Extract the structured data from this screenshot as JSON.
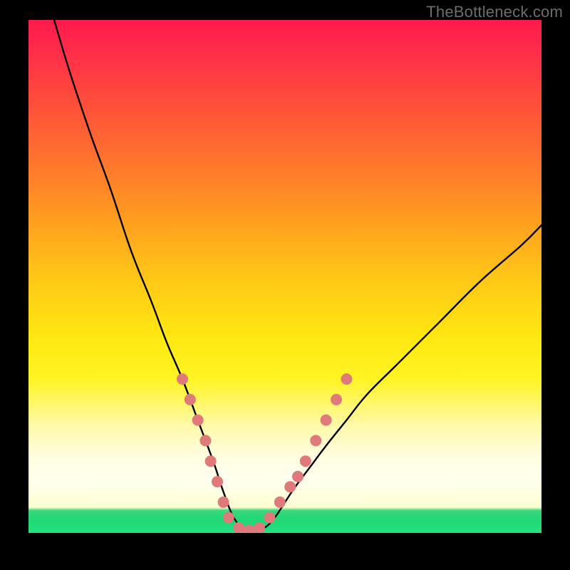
{
  "watermark": "TheBottleneck.com",
  "chart_data": {
    "type": "line",
    "title": "",
    "xlabel": "",
    "ylabel": "",
    "xlim": [
      0,
      100
    ],
    "ylim": [
      0,
      100
    ],
    "grid": false,
    "legend": false,
    "colors": {
      "curve": "#000000",
      "markers": "#e07a7a",
      "gradient_top": "#ff1a4d",
      "gradient_bottom": "#26e381"
    },
    "series": [
      {
        "name": "bottleneck-curve",
        "description": "V-shaped bottleneck-percentage curve; minimum (~0%) around x≈39..46, rising toward both ends. Left branch reaches 100% near x≈5; right branch reaches ~60% at x≈100.",
        "x": [
          5,
          8,
          12,
          16,
          20,
          24,
          27,
          30,
          33,
          36,
          38,
          40,
          42,
          44,
          46,
          48,
          50,
          52,
          55,
          58,
          62,
          66,
          72,
          80,
          88,
          96,
          100
        ],
        "values": [
          100,
          90,
          78,
          67,
          55,
          45,
          37,
          30,
          22,
          14,
          8,
          3,
          1,
          0.5,
          1,
          3,
          6,
          9,
          13,
          17,
          22,
          27,
          33,
          41,
          49,
          56,
          60
        ]
      }
    ],
    "markers": {
      "name": "highlight-dots",
      "description": "Salmon dots clustered on the lower portion of both branches and along the trough.",
      "points": [
        {
          "x": 30,
          "y": 30
        },
        {
          "x": 31.5,
          "y": 26
        },
        {
          "x": 33,
          "y": 22
        },
        {
          "x": 34.5,
          "y": 18
        },
        {
          "x": 35.5,
          "y": 14
        },
        {
          "x": 36.8,
          "y": 10
        },
        {
          "x": 38,
          "y": 6
        },
        {
          "x": 39,
          "y": 3
        },
        {
          "x": 41,
          "y": 1
        },
        {
          "x": 43,
          "y": 0.5
        },
        {
          "x": 45,
          "y": 1
        },
        {
          "x": 47,
          "y": 3
        },
        {
          "x": 49,
          "y": 6
        },
        {
          "x": 51,
          "y": 9
        },
        {
          "x": 52.5,
          "y": 11
        },
        {
          "x": 54,
          "y": 14
        },
        {
          "x": 56,
          "y": 18
        },
        {
          "x": 58,
          "y": 22
        },
        {
          "x": 60,
          "y": 26
        },
        {
          "x": 62,
          "y": 30
        }
      ]
    }
  }
}
